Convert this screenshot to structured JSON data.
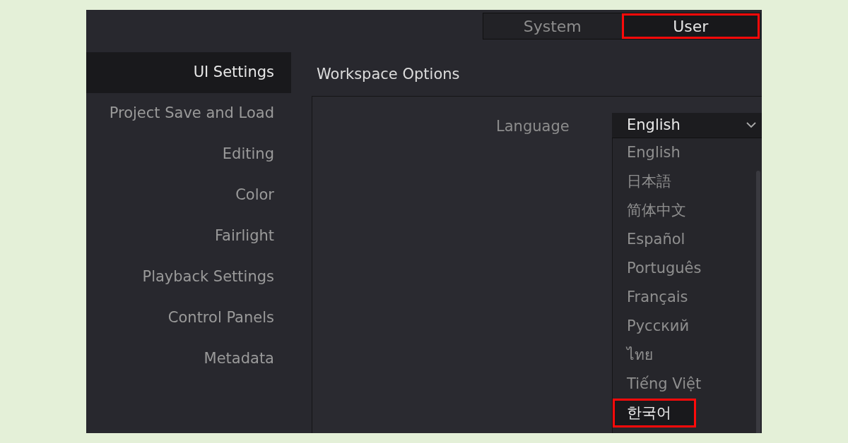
{
  "tabs": [
    {
      "label": "System",
      "selected": false,
      "highlighted": false
    },
    {
      "label": "User",
      "selected": true,
      "highlighted": true
    }
  ],
  "sidebar": {
    "items": [
      {
        "label": "UI Settings",
        "selected": true
      },
      {
        "label": "Project Save and Load",
        "selected": false
      },
      {
        "label": "Editing",
        "selected": false
      },
      {
        "label": "Color",
        "selected": false
      },
      {
        "label": "Fairlight",
        "selected": false
      },
      {
        "label": "Playback Settings",
        "selected": false
      },
      {
        "label": "Control Panels",
        "selected": false
      },
      {
        "label": "Metadata",
        "selected": false
      }
    ]
  },
  "section": {
    "title": "Workspace Options"
  },
  "language": {
    "label": "Language",
    "value": "English",
    "expanded": true,
    "options": [
      {
        "label": "English",
        "hovered": false,
        "highlighted": false
      },
      {
        "label": "日本語",
        "hovered": false,
        "highlighted": false
      },
      {
        "label": "简体中文",
        "hovered": false,
        "highlighted": false
      },
      {
        "label": "Español",
        "hovered": false,
        "highlighted": false
      },
      {
        "label": "Português",
        "hovered": false,
        "highlighted": false
      },
      {
        "label": "Français",
        "hovered": false,
        "highlighted": false
      },
      {
        "label": "Русский",
        "hovered": false,
        "highlighted": false
      },
      {
        "label": "ไทย",
        "hovered": false,
        "highlighted": false
      },
      {
        "label": "Tiếng Việt",
        "hovered": false,
        "highlighted": false
      },
      {
        "label": "한국어",
        "hovered": true,
        "highlighted": true
      }
    ]
  }
}
